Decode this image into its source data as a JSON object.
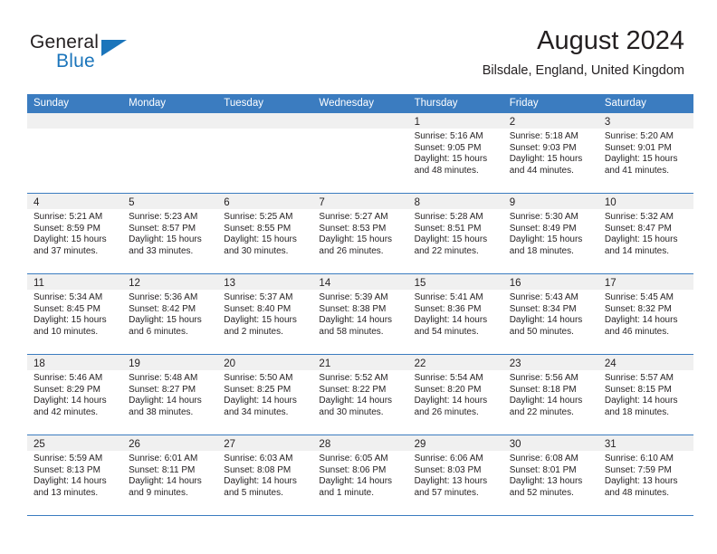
{
  "brand": {
    "name_part1": "General",
    "name_part2": "Blue",
    "accent_color": "#1b75bb"
  },
  "header": {
    "title": "August 2024",
    "subtitle": "Bilsdale, England, United Kingdom"
  },
  "theme": {
    "header_blue": "#3b7cc0",
    "day_band_gray": "#f0f0f0",
    "text_color": "#231f20"
  },
  "weekdays": [
    "Sunday",
    "Monday",
    "Tuesday",
    "Wednesday",
    "Thursday",
    "Friday",
    "Saturday"
  ],
  "weeks": [
    [
      {
        "blank": true
      },
      {
        "blank": true
      },
      {
        "blank": true
      },
      {
        "blank": true
      },
      {
        "day": "1",
        "sunrise": "Sunrise: 5:16 AM",
        "sunset": "Sunset: 9:05 PM",
        "daylight": "Daylight: 15 hours and 48 minutes."
      },
      {
        "day": "2",
        "sunrise": "Sunrise: 5:18 AM",
        "sunset": "Sunset: 9:03 PM",
        "daylight": "Daylight: 15 hours and 44 minutes."
      },
      {
        "day": "3",
        "sunrise": "Sunrise: 5:20 AM",
        "sunset": "Sunset: 9:01 PM",
        "daylight": "Daylight: 15 hours and 41 minutes."
      }
    ],
    [
      {
        "day": "4",
        "sunrise": "Sunrise: 5:21 AM",
        "sunset": "Sunset: 8:59 PM",
        "daylight": "Daylight: 15 hours and 37 minutes."
      },
      {
        "day": "5",
        "sunrise": "Sunrise: 5:23 AM",
        "sunset": "Sunset: 8:57 PM",
        "daylight": "Daylight: 15 hours and 33 minutes."
      },
      {
        "day": "6",
        "sunrise": "Sunrise: 5:25 AM",
        "sunset": "Sunset: 8:55 PM",
        "daylight": "Daylight: 15 hours and 30 minutes."
      },
      {
        "day": "7",
        "sunrise": "Sunrise: 5:27 AM",
        "sunset": "Sunset: 8:53 PM",
        "daylight": "Daylight: 15 hours and 26 minutes."
      },
      {
        "day": "8",
        "sunrise": "Sunrise: 5:28 AM",
        "sunset": "Sunset: 8:51 PM",
        "daylight": "Daylight: 15 hours and 22 minutes."
      },
      {
        "day": "9",
        "sunrise": "Sunrise: 5:30 AM",
        "sunset": "Sunset: 8:49 PM",
        "daylight": "Daylight: 15 hours and 18 minutes."
      },
      {
        "day": "10",
        "sunrise": "Sunrise: 5:32 AM",
        "sunset": "Sunset: 8:47 PM",
        "daylight": "Daylight: 15 hours and 14 minutes."
      }
    ],
    [
      {
        "day": "11",
        "sunrise": "Sunrise: 5:34 AM",
        "sunset": "Sunset: 8:45 PM",
        "daylight": "Daylight: 15 hours and 10 minutes."
      },
      {
        "day": "12",
        "sunrise": "Sunrise: 5:36 AM",
        "sunset": "Sunset: 8:42 PM",
        "daylight": "Daylight: 15 hours and 6 minutes."
      },
      {
        "day": "13",
        "sunrise": "Sunrise: 5:37 AM",
        "sunset": "Sunset: 8:40 PM",
        "daylight": "Daylight: 15 hours and 2 minutes."
      },
      {
        "day": "14",
        "sunrise": "Sunrise: 5:39 AM",
        "sunset": "Sunset: 8:38 PM",
        "daylight": "Daylight: 14 hours and 58 minutes."
      },
      {
        "day": "15",
        "sunrise": "Sunrise: 5:41 AM",
        "sunset": "Sunset: 8:36 PM",
        "daylight": "Daylight: 14 hours and 54 minutes."
      },
      {
        "day": "16",
        "sunrise": "Sunrise: 5:43 AM",
        "sunset": "Sunset: 8:34 PM",
        "daylight": "Daylight: 14 hours and 50 minutes."
      },
      {
        "day": "17",
        "sunrise": "Sunrise: 5:45 AM",
        "sunset": "Sunset: 8:32 PM",
        "daylight": "Daylight: 14 hours and 46 minutes."
      }
    ],
    [
      {
        "day": "18",
        "sunrise": "Sunrise: 5:46 AM",
        "sunset": "Sunset: 8:29 PM",
        "daylight": "Daylight: 14 hours and 42 minutes."
      },
      {
        "day": "19",
        "sunrise": "Sunrise: 5:48 AM",
        "sunset": "Sunset: 8:27 PM",
        "daylight": "Daylight: 14 hours and 38 minutes."
      },
      {
        "day": "20",
        "sunrise": "Sunrise: 5:50 AM",
        "sunset": "Sunset: 8:25 PM",
        "daylight": "Daylight: 14 hours and 34 minutes."
      },
      {
        "day": "21",
        "sunrise": "Sunrise: 5:52 AM",
        "sunset": "Sunset: 8:22 PM",
        "daylight": "Daylight: 14 hours and 30 minutes."
      },
      {
        "day": "22",
        "sunrise": "Sunrise: 5:54 AM",
        "sunset": "Sunset: 8:20 PM",
        "daylight": "Daylight: 14 hours and 26 minutes."
      },
      {
        "day": "23",
        "sunrise": "Sunrise: 5:56 AM",
        "sunset": "Sunset: 8:18 PM",
        "daylight": "Daylight: 14 hours and 22 minutes."
      },
      {
        "day": "24",
        "sunrise": "Sunrise: 5:57 AM",
        "sunset": "Sunset: 8:15 PM",
        "daylight": "Daylight: 14 hours and 18 minutes."
      }
    ],
    [
      {
        "day": "25",
        "sunrise": "Sunrise: 5:59 AM",
        "sunset": "Sunset: 8:13 PM",
        "daylight": "Daylight: 14 hours and 13 minutes."
      },
      {
        "day": "26",
        "sunrise": "Sunrise: 6:01 AM",
        "sunset": "Sunset: 8:11 PM",
        "daylight": "Daylight: 14 hours and 9 minutes."
      },
      {
        "day": "27",
        "sunrise": "Sunrise: 6:03 AM",
        "sunset": "Sunset: 8:08 PM",
        "daylight": "Daylight: 14 hours and 5 minutes."
      },
      {
        "day": "28",
        "sunrise": "Sunrise: 6:05 AM",
        "sunset": "Sunset: 8:06 PM",
        "daylight": "Daylight: 14 hours and 1 minute."
      },
      {
        "day": "29",
        "sunrise": "Sunrise: 6:06 AM",
        "sunset": "Sunset: 8:03 PM",
        "daylight": "Daylight: 13 hours and 57 minutes."
      },
      {
        "day": "30",
        "sunrise": "Sunrise: 6:08 AM",
        "sunset": "Sunset: 8:01 PM",
        "daylight": "Daylight: 13 hours and 52 minutes."
      },
      {
        "day": "31",
        "sunrise": "Sunrise: 6:10 AM",
        "sunset": "Sunset: 7:59 PM",
        "daylight": "Daylight: 13 hours and 48 minutes."
      }
    ]
  ]
}
